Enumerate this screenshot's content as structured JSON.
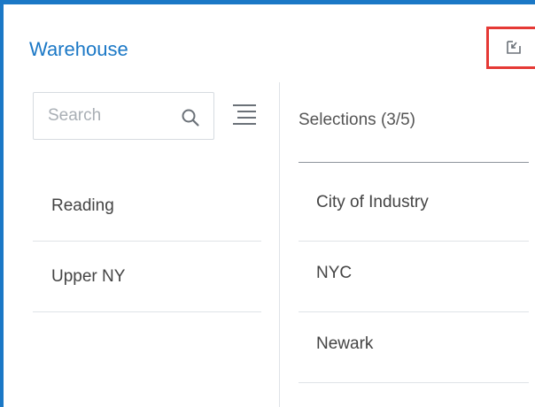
{
  "header": {
    "title": "Warehouse",
    "popout_icon": "popout-icon"
  },
  "search": {
    "placeholder": "Search",
    "value": "",
    "icon": "search-icon"
  },
  "sort": {
    "icon": "sort-lines-icon"
  },
  "available": {
    "items": [
      {
        "label": "Reading"
      },
      {
        "label": "Upper NY"
      }
    ]
  },
  "selections": {
    "header": "Selections (3/5)",
    "items": [
      {
        "label": "City of Industry"
      },
      {
        "label": "NYC"
      },
      {
        "label": "Newark"
      }
    ]
  },
  "colors": {
    "accent": "#1b78c6",
    "highlight_border": "#e53935",
    "divider": "#dfe3e7",
    "text": "#444444",
    "placeholder": "#a9afb5"
  }
}
